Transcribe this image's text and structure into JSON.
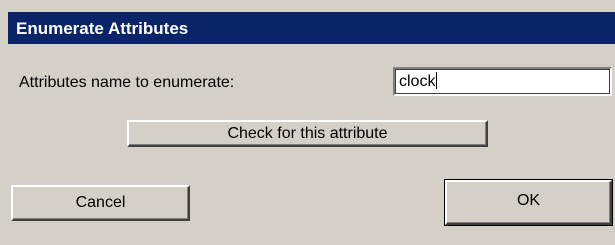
{
  "window": {
    "title": "Enumerate Attributes"
  },
  "form": {
    "label": "Attributes name to enumerate:",
    "value": "clock"
  },
  "buttons": {
    "check_label": "Check for this attribute",
    "cancel_label": "Cancel",
    "ok_label": "OK"
  },
  "colors": {
    "titlebar": "#0a246a",
    "face": "#d4d0c8"
  }
}
